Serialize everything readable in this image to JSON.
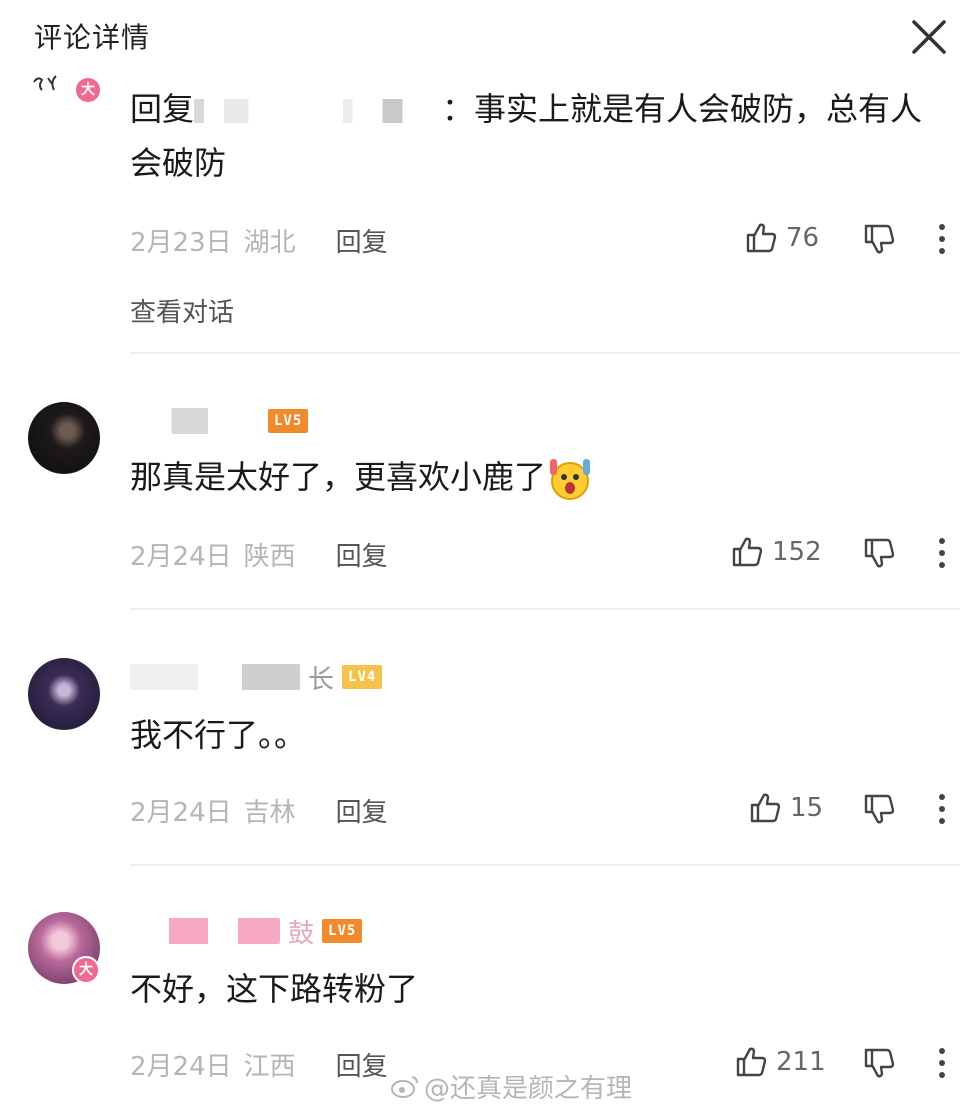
{
  "header": {
    "title": "评论详情"
  },
  "comments": [
    {
      "reply_prefix": "回复",
      "text": "：事实上就是有人会破防，总有人会破防",
      "date": "2月23日",
      "location": "湖北",
      "reply_label": "回复",
      "likes": "76",
      "view_conversation": "查看对话",
      "avatar_badge": "大"
    },
    {
      "level": "LV5",
      "text": "那真是太好了，更喜欢小鹿了",
      "date": "2月24日",
      "location": "陕西",
      "reply_label": "回复",
      "likes": "152"
    },
    {
      "name_suffix": "长",
      "level": "LV4",
      "text": "我不行了。。",
      "date": "2月24日",
      "location": "吉林",
      "reply_label": "回复",
      "likes": "15"
    },
    {
      "name_suffix": "鼓",
      "level": "LV5",
      "text": "不好，这下路转粉了",
      "date": "2月24日",
      "location": "江西",
      "reply_label": "回复",
      "likes": "211",
      "avatar_badge": "大"
    }
  ],
  "watermark": "@还真是颜之有理",
  "icons": {
    "close": "close-icon",
    "like": "thumbs-up-icon",
    "dislike": "thumbs-down-icon",
    "more": "more-vertical-icon",
    "weibo": "weibo-logo-icon",
    "emoji": "shocked-face-emoji"
  },
  "colors": {
    "level_badge": "#f08a2c",
    "level_badge_lv4": "#f5c24a",
    "vip_badge": "#f06a8f",
    "meta_text": "#b5b5b5"
  }
}
